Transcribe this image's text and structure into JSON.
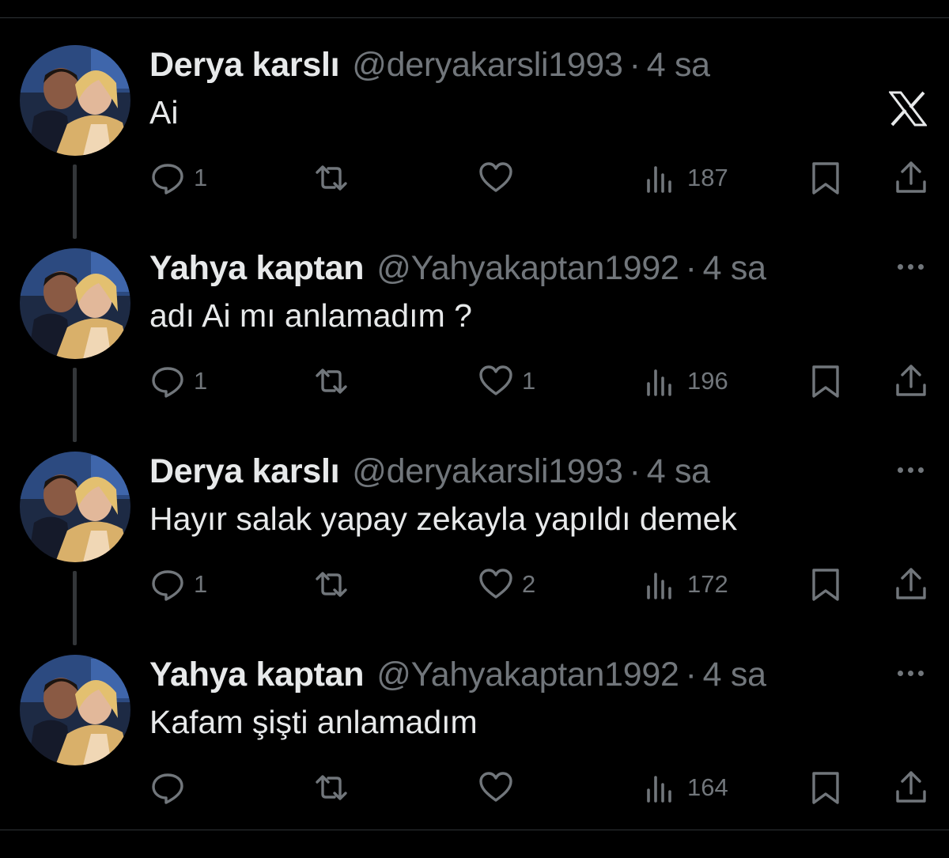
{
  "tweets": [
    {
      "name": "Derya karslı",
      "handle": "@deryakarsli1993",
      "separator": "·",
      "time": "4 sa",
      "text": "Ai",
      "counts": {
        "replies": "1",
        "retweets": "",
        "likes": "",
        "views": "187"
      },
      "corner": "x-logo-icon"
    },
    {
      "name": "Yahya kaptan",
      "handle": "@Yahyakaptan1992",
      "separator": "·",
      "time": "4 sa",
      "text": "adı Ai mı anlamadım ?",
      "counts": {
        "replies": "1",
        "retweets": "",
        "likes": "1",
        "views": "196"
      },
      "corner": "more-icon"
    },
    {
      "name": "Derya karslı",
      "handle": "@deryakarsli1993",
      "separator": "·",
      "time": "4 sa",
      "text": "Hayır salak yapay zekayla yapıldı demek",
      "counts": {
        "replies": "1",
        "retweets": "",
        "likes": "2",
        "views": "172"
      },
      "corner": "more-icon"
    },
    {
      "name": "Yahya kaptan",
      "handle": "@Yahyakaptan1992",
      "separator": "·",
      "time": "4 sa",
      "text": "Kafam şişti anlamadım",
      "counts": {
        "replies": "",
        "retweets": "",
        "likes": "",
        "views": "164"
      },
      "corner": "more-icon"
    }
  ],
  "colors": {
    "background": "#000000",
    "primary_text": "#e7e9ea",
    "secondary_text": "#71767b",
    "divider": "#2f3336",
    "thread_line": "#333639"
  }
}
